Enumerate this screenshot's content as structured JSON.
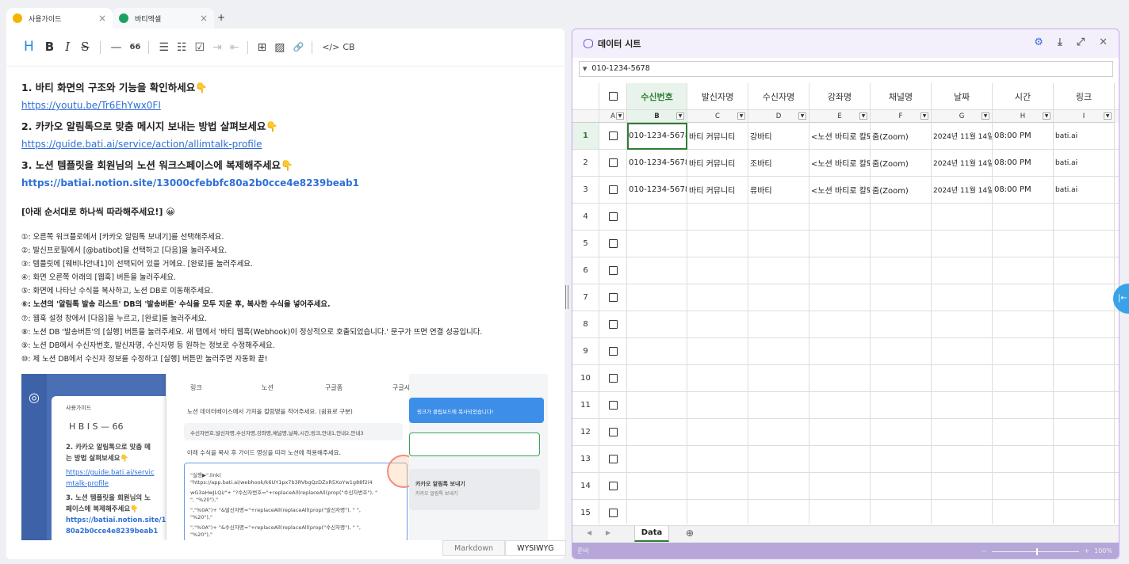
{
  "tabs": [
    {
      "label": "사용가이드",
      "color": "#f5b400",
      "close": "×"
    },
    {
      "label": "바티엑셀",
      "color": "#1aa260",
      "close": "×"
    }
  ],
  "new_tab": "+",
  "toolbar": {
    "h": "H",
    "b": "B",
    "i": "I",
    "s": "S",
    "hr": "—",
    "quote": "66",
    "ul": "☰",
    "ol": "☷",
    "task": "☑",
    "indent": "⇥",
    "outdent": "⇤",
    "table": "⊞",
    "image": "▨",
    "link": "🔗",
    "code": "</>",
    "cb": "CB"
  },
  "guide": {
    "h1": "1. 바티 화면의 구조와 기능을 확인하세요👇",
    "link1": "https://youtu.be/Tr6EhYwx0FI",
    "h2": "2. 카카오 알림톡으로 맞춤 메시지 보내는 방법 살펴보세요👇",
    "link2": "https://guide.bati.ai/service/action/allimtalk-profile",
    "h3": "3. 노션 템플릿을 회원님의 노션 워크스페이스에 복제해주세요👇",
    "link3": "https://batiai.notion.site/13000cfebbfc80a2b0cce4e8239beab1",
    "note": "[아래 순서대로 하나씩 따라해주세요!] 😀",
    "steps": [
      "①: 오른쪽 워크플로에서 [카카오 알림톡 보내기]를 선택해주세요.",
      "②: 발신프로필에서 [@batibot]을 선택하고 [다음]을 눌러주세요.",
      "③: 템플릿에 [웨비나안내1]이 선택되어 있을 거에요. [완료]를 눌러주세요.",
      "④: 화면 오른쪽 아래의 [웹훅] 버튼을 눌러주세요.",
      "⑤: 화면에 나타난 수식을 복사하고, 노션 DB로 이동해주세요.",
      "⑥: 노션의 '알림톡 발송 리스트' DB의 '발송버튼' 수식을 모두 지운 후, 복사한 수식을 넣어주세요.",
      "⑦: 웹훅 설정 창에서 [다음]을 누르고, [완료]를 눌러주세요.",
      "⑧: 노션 DB '발송버튼'의 [실행] 버튼을 눌러주세요. 새 탭에서 '바티 웹훅(Webhook)이 정상적으로 호출되었습니다.' 문구가 뜨면 연결 성공입니다.",
      "⑨: 노션 DB에서 수신자번호, 발신자명, 수신자명 등 원하는 정보로 수정해주세요.",
      "⑩: 제 노션 DB에서 수신자 정보를 수정하고 [실행] 버튼만 눌러주면 자동화 끝!"
    ],
    "shot": {
      "tab1": "사용가이드",
      "opt1": "링크",
      "opt2": "노션",
      "opt3": "구글폼",
      "opt4": "구글시트",
      "label1": "노션 데이터베이스에서 가져올 컬럼명을 적어주세요. (쉼표로 구분)",
      "cols": "수신자번호,발신자명,수신자명,강좌명,채널명,날짜,시간,링크,안내1,안내2,안내3",
      "label2": "아래 수식을 복사 후 가이드 영상을 따라 노션에 적용해주세요.",
      "code1": "\"실행▶\".link(",
      "code2": "\"https://app.bati.ai/webhook/k6UY1px7b3RVbgQzDZxR5XoYw1g88f2i4",
      "code3": "wG3aHwJLQi/\"+  \"?수신자번호=\"+replaceAll(replaceAll(prop(\"수신자번호\"), \"",
      "code4": "\", \"%20\"),\"",
      "code5": "\",\"%0A\")+  \"&발신자명=\"+replaceAll(replaceAll(prop(\"발신자명\"), \" \",",
      "code6": "\"%20\"),\"",
      "code7": "\",\"%0A\")+  \"&수신자명=\"+replaceAll(replaceAll(prop(\"수신자명\"), \" \",",
      "code8": "\"%20\"),\"",
      "toast": "링크가 클립보드에 복사되었습니다!",
      "left1": "2. 카카오 알림톡으로 맞춤 메",
      "left2": "는 방법 살펴보세요👇",
      "left3": "https://guide.bati.ai/servic",
      "left4": "mtalk-profile",
      "left5": "3. 노션 템플릿을 회원님의 노",
      "left6": "페이스에 복제해주세요👇",
      "left7": "https://batiai.notion.site/1",
      "left8": "80a2b0cce4e8239beab1",
      "right1": "카카오 알림톡 보내기",
      "right2": "카카오 알림톡 보내기"
    }
  },
  "modes": [
    "Markdown",
    "WYSIWYG"
  ],
  "sheet": {
    "title": "데이터 시트",
    "cell_value": "010-1234-5678",
    "headers": [
      "수신번호",
      "발신자명",
      "수신자명",
      "강좌명",
      "채널명",
      "날짜",
      "시간",
      "링크"
    ],
    "col_letters": [
      "A",
      "B",
      "C",
      "D",
      "E",
      "F",
      "G",
      "H",
      "I"
    ],
    "rows": [
      [
        "010-1234-5678",
        "바티 커뮤니티",
        "강바티",
        "<노션 바티로 칼퇴",
        "줌(Zoom)",
        "2024년 11월 14일",
        "08:00 PM",
        "bati.ai"
      ],
      [
        "010-1234-5678",
        "바티 커뮤니티",
        "조바티",
        "<노션 바티로 칼퇴",
        "줌(Zoom)",
        "2024년 11월 14일",
        "08:00 PM",
        "bati.ai"
      ],
      [
        "010-1234-5678",
        "바티 커뮤니티",
        "류바티",
        "<노션 바티로 칼퇴",
        "줌(Zoom)",
        "2024년 11월 14일",
        "08:00 PM",
        "bati.ai"
      ]
    ],
    "row_numbers": [
      "1",
      "2",
      "3",
      "4",
      "5",
      "6",
      "7",
      "8",
      "9",
      "10",
      "11",
      "12",
      "13",
      "14",
      "15"
    ],
    "sheet_tab": "Data",
    "add_sheet": "⊕",
    "status": "준비",
    "zoom": "100%",
    "zoom_minus": "—",
    "zoom_plus": "+",
    "accent": "#2e7d32"
  }
}
